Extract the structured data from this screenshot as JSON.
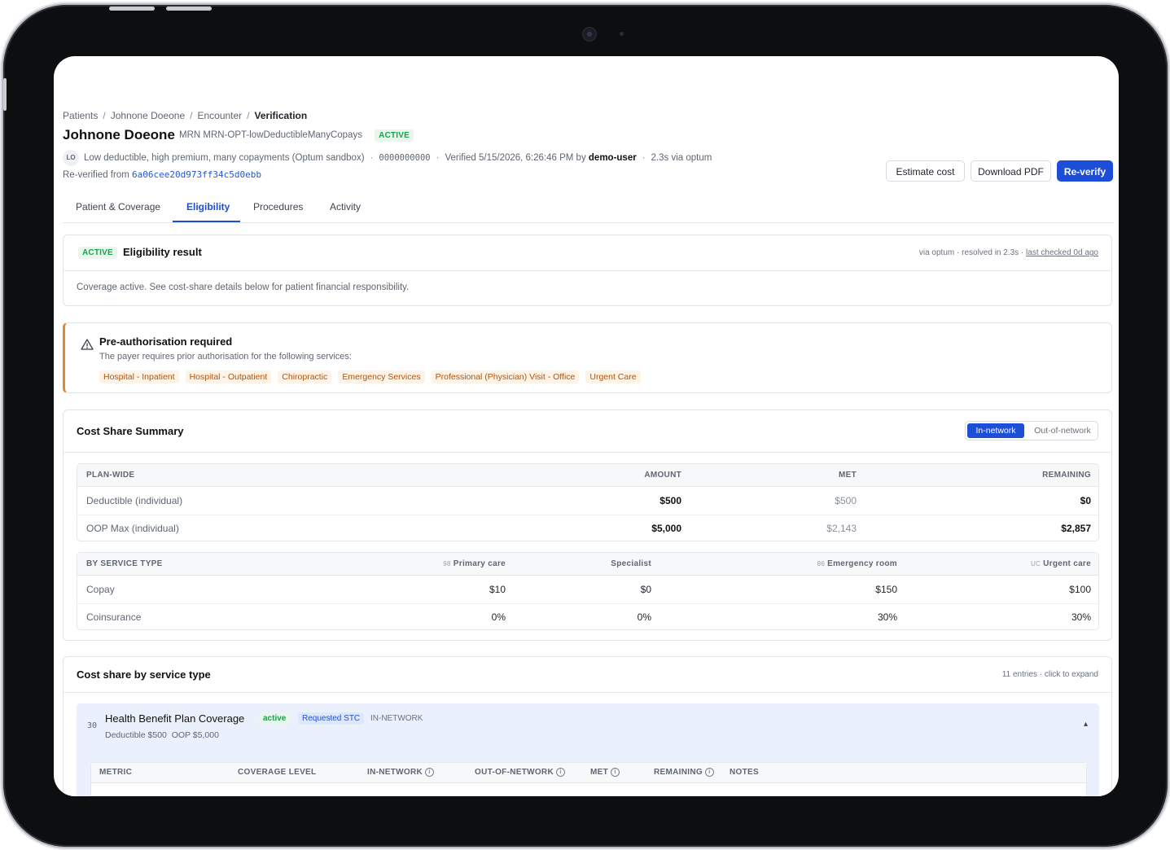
{
  "breadcrumb": [
    "Patients",
    "Johnone Doeone",
    "Encounter",
    "Verification"
  ],
  "patient": {
    "name": "Johnone Doeone",
    "mrn": "MRN MRN-OPT-lowDeductibleManyCopays",
    "status": "ACTIVE",
    "avatar": "LO",
    "plan_desc": "Low deductible, high premium, many copayments (Optum sandbox)",
    "member_id": "0000000000",
    "verified_prefix": "Verified 5/15/2026, 6:26:46 PM by",
    "verified_by": "demo-user",
    "timing": "2.3s via optum",
    "reverified_label": "Re-verified from",
    "reverified_id": "6a06cee20d973ff34c5d0ebb"
  },
  "actions": {
    "estimate": "Estimate cost",
    "download": "Download PDF",
    "reverify": "Re-verify"
  },
  "tabs": [
    "Patient & Coverage",
    "Eligibility",
    "Procedures",
    "Activity"
  ],
  "eligibility": {
    "status": "ACTIVE",
    "title": "Eligibility result",
    "meta": "via optum · resolved in 2.3s ·",
    "last_checked": "last checked 0d ago",
    "body": "Coverage active. See cost-share details below for patient financial responsibility."
  },
  "preauth": {
    "title": "Pre-authorisation required",
    "body": "The payer requires prior authorisation for the following services:",
    "tags": [
      "Hospital - Inpatient",
      "Hospital - Outpatient",
      "Chiropractic",
      "Emergency Services",
      "Professional (Physician) Visit - Office",
      "Urgent Care"
    ],
    "icon": "warning-icon"
  },
  "cost_share": {
    "title": "Cost Share Summary",
    "toggle": [
      "In-network",
      "Out-of-network"
    ],
    "plan_headers": [
      "PLAN-WIDE",
      "AMOUNT",
      "MET",
      "REMAINING"
    ],
    "plan_rows": [
      {
        "label": "Deductible (individual)",
        "amount": "$500",
        "met": "$500",
        "remaining": "$0"
      },
      {
        "label": "OOP Max (individual)",
        "amount": "$5,000",
        "met": "$2,143",
        "remaining": "$2,857"
      }
    ],
    "service_headers": {
      "label": "BY SERVICE TYPE",
      "cols": [
        {
          "code": "98",
          "name": "Primary care"
        },
        {
          "code": "",
          "name": "Specialist"
        },
        {
          "code": "86",
          "name": "Emergency room"
        },
        {
          "code": "UC",
          "name": "Urgent care"
        }
      ]
    },
    "service_rows": [
      {
        "label": "Copay",
        "values": [
          "$10",
          "$0",
          "$150",
          "$100"
        ]
      },
      {
        "label": "Coinsurance",
        "values": [
          "0%",
          "0%",
          "30%",
          "30%"
        ]
      }
    ]
  },
  "by_service": {
    "title": "Cost share by service type",
    "meta": "11 entries · click to expand",
    "item": {
      "code": "30",
      "name": "Health Benefit Plan Coverage",
      "status": "active",
      "tag": "Requested STC",
      "network": "IN-NETWORK",
      "sub": "Deductible $500  OOP $5,000",
      "chevron": "▴"
    },
    "metric_headers": [
      "METRIC",
      "COVERAGE LEVEL",
      "IN-NETWORK",
      "OUT-OF-NETWORK",
      "MET",
      "REMAINING",
      "NOTES"
    ]
  }
}
